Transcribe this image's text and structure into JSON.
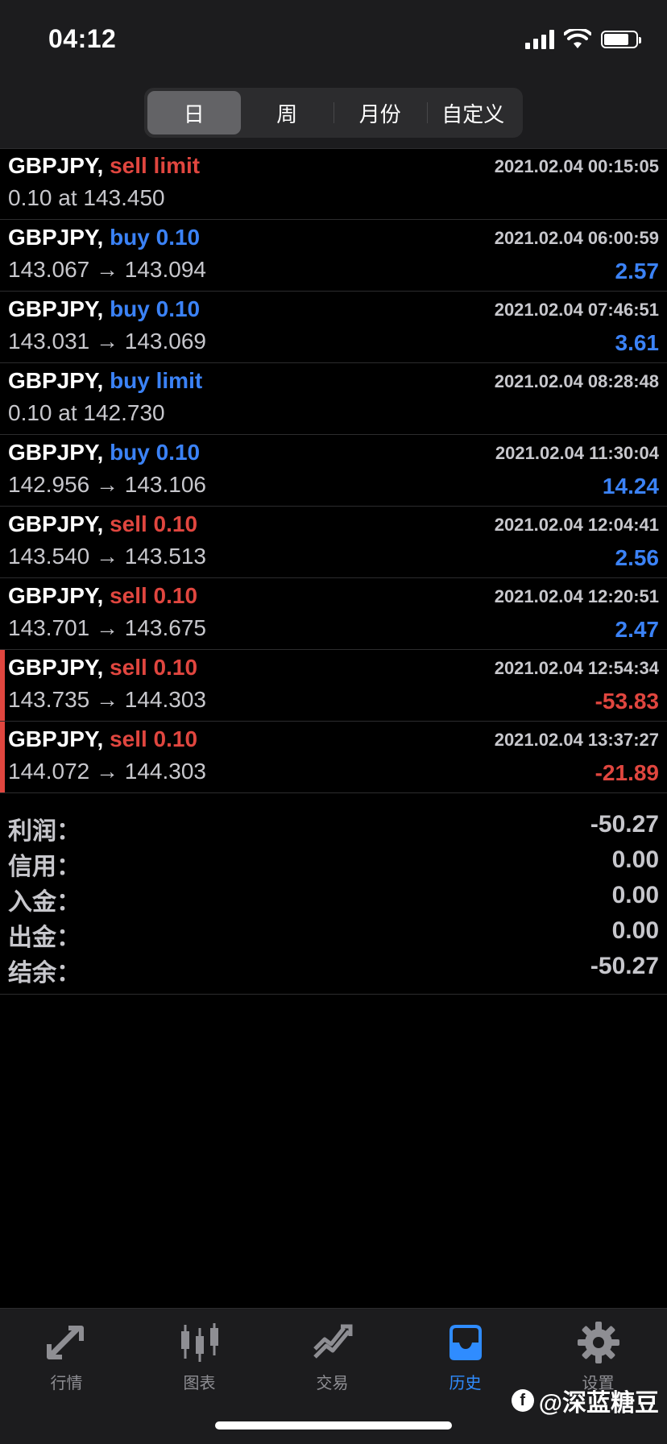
{
  "status_bar": {
    "time": "04:12"
  },
  "segments": [
    {
      "label": "日",
      "active": true
    },
    {
      "label": "周",
      "active": false
    },
    {
      "label": "月份",
      "active": false
    },
    {
      "label": "自定义",
      "active": false
    }
  ],
  "trades": [
    {
      "symbol": "GBPJPY,",
      "type": "sell limit",
      "side": "sell",
      "time": "2021.02.04 00:15:05",
      "detail": "0.10 at 143.450",
      "profit": ""
    },
    {
      "symbol": "GBPJPY,",
      "type": "buy 0.10",
      "side": "buy",
      "time": "2021.02.04 06:00:59",
      "detail": "143.067 → 143.094",
      "profit": "2.57"
    },
    {
      "symbol": "GBPJPY,",
      "type": "buy 0.10",
      "side": "buy",
      "time": "2021.02.04 07:46:51",
      "detail": "143.031 → 143.069",
      "profit": "3.61"
    },
    {
      "symbol": "GBPJPY,",
      "type": "buy limit",
      "side": "buy",
      "time": "2021.02.04 08:28:48",
      "detail": "0.10 at 142.730",
      "profit": ""
    },
    {
      "symbol": "GBPJPY,",
      "type": "buy 0.10",
      "side": "buy",
      "time": "2021.02.04 11:30:04",
      "detail": "142.956 → 143.106",
      "profit": "14.24"
    },
    {
      "symbol": "GBPJPY,",
      "type": "sell 0.10",
      "side": "sell",
      "time": "2021.02.04 12:04:41",
      "detail": "143.540 → 143.513",
      "profit": "2.56"
    },
    {
      "symbol": "GBPJPY,",
      "type": "sell 0.10",
      "side": "sell",
      "time": "2021.02.04 12:20:51",
      "detail": "143.701 → 143.675",
      "profit": "2.47"
    },
    {
      "symbol": "GBPJPY,",
      "type": "sell 0.10",
      "side": "sell",
      "time": "2021.02.04 12:54:34",
      "detail": "143.735 → 144.303",
      "profit": "-53.83"
    },
    {
      "symbol": "GBPJPY,",
      "type": "sell 0.10",
      "side": "sell",
      "time": "2021.02.04 13:37:27",
      "detail": "144.072 → 144.303",
      "profit": "-21.89"
    }
  ],
  "summary": [
    {
      "label": "利润：",
      "value": "-50.27"
    },
    {
      "label": "信用：",
      "value": "0.00"
    },
    {
      "label": "入金：",
      "value": "0.00"
    },
    {
      "label": "出金：",
      "value": "0.00"
    },
    {
      "label": "结余：",
      "value": "-50.27"
    }
  ],
  "tabs": [
    {
      "label": "行情",
      "icon": "quotes-arrows-icon",
      "active": false
    },
    {
      "label": "图表",
      "icon": "candlestick-chart-icon",
      "active": false
    },
    {
      "label": "交易",
      "icon": "trade-trend-icon",
      "active": false
    },
    {
      "label": "历史",
      "icon": "history-inbox-icon",
      "active": true
    },
    {
      "label": "设置",
      "icon": "gear-icon",
      "active": false
    }
  ],
  "watermark": "@深蓝糖豆",
  "colors": {
    "buy": "#3b82f6",
    "sell": "#e0463f",
    "active_tab": "#2f8cff"
  }
}
